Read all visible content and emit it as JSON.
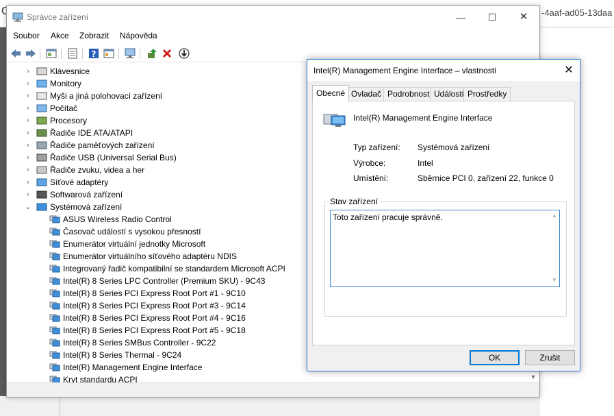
{
  "background": {
    "url_fragment": "-4aaf-ad05-13daa"
  },
  "window": {
    "title": "Správce zařízení",
    "min_glyph": "—",
    "max_glyph": "☐",
    "close_glyph": "✕"
  },
  "menu": [
    "Soubor",
    "Akce",
    "Zobrazit",
    "Nápověda"
  ],
  "toolbar_icons": [
    "back-arrow-icon",
    "forward-arrow-icon",
    "properties-window-icon",
    "list-view-icon",
    "help-icon",
    "details-view-icon",
    "monitor-icon",
    "update-driver-icon",
    "uninstall-x-icon",
    "download-arrow-icon"
  ],
  "tree": {
    "categories": [
      {
        "label": "Klávesnice",
        "icon": "keyboard-icon"
      },
      {
        "label": "Monitory",
        "icon": "monitor-icon"
      },
      {
        "label": "Myši a jiná polohovací zařízení",
        "icon": "mouse-icon"
      },
      {
        "label": "Počítač",
        "icon": "computer-icon"
      },
      {
        "label": "Procesory",
        "icon": "processor-icon"
      },
      {
        "label": "Řadiče IDE ATA/ATAPI",
        "icon": "ide-controller-icon"
      },
      {
        "label": "Řadiče paměťových zařízení",
        "icon": "storage-controller-icon"
      },
      {
        "label": "Řadiče USB (Universal Serial Bus)",
        "icon": "usb-icon"
      },
      {
        "label": "Řadiče zvuku, videa a her",
        "icon": "speaker-icon"
      },
      {
        "label": "Síťové adaptéry",
        "icon": "network-adapter-icon"
      },
      {
        "label": "Softwarová zařízení",
        "icon": "software-device-icon"
      },
      {
        "label": "Systémová zařízení",
        "icon": "system-device-icon",
        "expanded": true
      }
    ],
    "children": [
      "ASUS Wireless Radio Control",
      "Časovač událostí s vysokou přesností",
      "Enumerátor virtuální jednotky Microsoft",
      "Enumerátor virtuálního síťového adaptéru NDIS",
      "Integrovaný řadič kompatibilní se standardem Microsoft ACPI",
      "Intel(R) 8 Series LPC Controller (Premium SKU) - 9C43",
      "Intel(R) 8 Series PCI Express Root Port #1 - 9C10",
      "Intel(R) 8 Series PCI Express Root Port #3 - 9C14",
      "Intel(R) 8 Series PCI Express Root Port #4 - 9C16",
      "Intel(R) 8 Series PCI Express Root Port #5 - 9C18",
      "Intel(R) 8 Series SMBus Controller - 9C22",
      "Intel(R) 8 Series Thermal - 9C24",
      "Intel(R) Management Engine Interface",
      "Kryt standardu ACPI"
    ]
  },
  "dialog": {
    "title": "Intel(R) Management Engine Interface  – vlastnosti",
    "close_glyph": "✕",
    "tabs": [
      "Obecné",
      "Ovladač",
      "Podrobnosti",
      "Události",
      "Prostředky"
    ],
    "active_tab": "Obecné",
    "device_name": "Intel(R) Management Engine Interface",
    "props": [
      {
        "key": "Typ zařízení:",
        "value": "Systémová zařízení"
      },
      {
        "key": "Výrobce:",
        "value": "Intel"
      },
      {
        "key": "Umístění:",
        "value": "Sběrnice PCI 0, zařízení 22, funkce 0"
      }
    ],
    "status_label": "Stav zařízení",
    "status_text": "Toto zařízení pracuje správně.",
    "ok": "OK",
    "cancel": "Zrušit"
  }
}
